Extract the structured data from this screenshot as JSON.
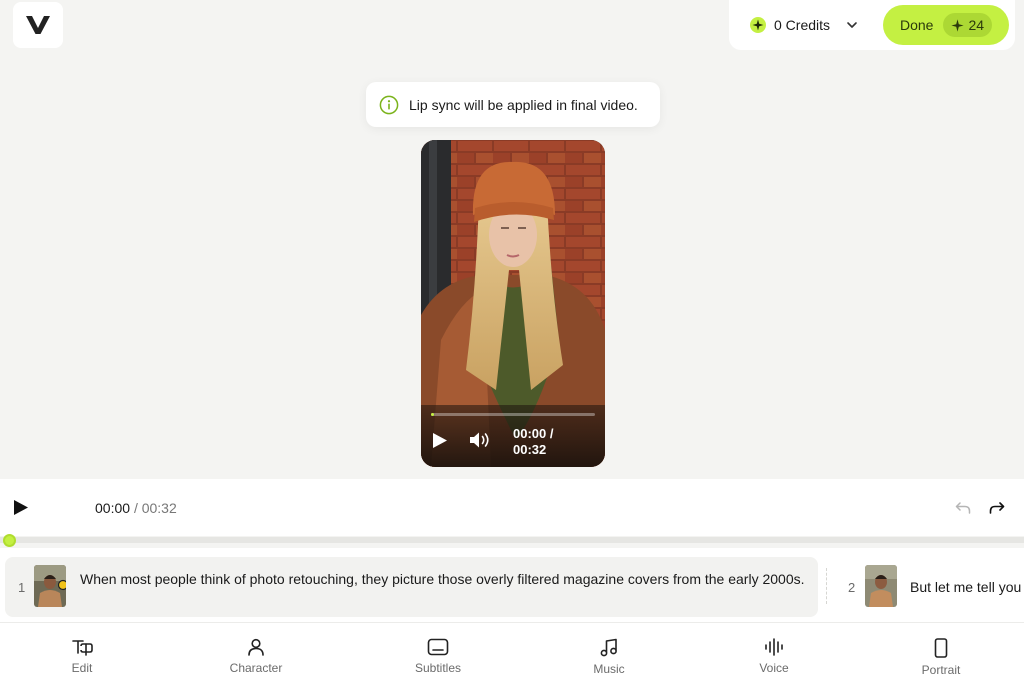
{
  "header": {
    "logo_letter": "V",
    "credits_label": "0 Credits",
    "done_label": "Done",
    "done_badge_value": "24"
  },
  "toast": {
    "message": "Lip sync will be applied in final video."
  },
  "video": {
    "current": "00:00 /",
    "duration": "00:32",
    "progress_fraction": 0.02
  },
  "timeline": {
    "current": "00:00",
    "separator": "/",
    "duration": "00:32"
  },
  "scenes": [
    {
      "number": "1",
      "text": "When most people think of photo retouching, they picture those overly filtered magazine covers from the early 2000s."
    },
    {
      "number": "2",
      "text": "But let me tell you"
    }
  ],
  "nav": [
    {
      "label": "Edit",
      "icon": "edit-icon"
    },
    {
      "label": "Character",
      "icon": "person-icon"
    },
    {
      "label": "Subtitles",
      "icon": "subtitles-icon"
    },
    {
      "label": "Music",
      "icon": "music-note-icon"
    },
    {
      "label": "Voice",
      "icon": "waveform-icon"
    },
    {
      "label": "Portrait",
      "icon": "phone-portrait-icon"
    }
  ],
  "colors": {
    "accent": "#c4f042",
    "background": "#f4f4f2"
  }
}
